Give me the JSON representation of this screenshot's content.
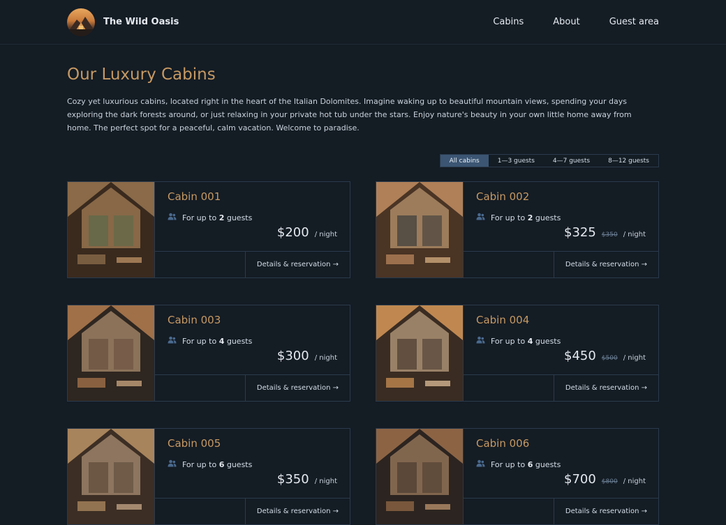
{
  "header": {
    "brand": "The Wild Oasis",
    "nav": [
      "Cabins",
      "About",
      "Guest area"
    ]
  },
  "page": {
    "title": "Our Luxury Cabins",
    "intro": "Cozy yet luxurious cabins, located right in the heart of the Italian Dolomites. Imagine waking up to beautiful mountain views, spending your days exploring the dark forests around, or just relaxing in your private hot tub under the stars. Enjoy nature's beauty in your own little home away from home. The perfect spot for a peaceful, calm vacation. Welcome to paradise."
  },
  "filter": {
    "options": [
      "All cabins",
      "1—3 guests",
      "4—7 guests",
      "8—12 guests"
    ],
    "active": "All cabins"
  },
  "cabin_ui": {
    "guests_prefix": "For up to",
    "guests_suffix": "guests",
    "per_night": "/ night",
    "details_label": "Details & reservation →"
  },
  "cabins": [
    {
      "name": "Cabin 001",
      "guests": "2",
      "price": "$200",
      "old_price": ""
    },
    {
      "name": "Cabin 002",
      "guests": "2",
      "price": "$325",
      "old_price": "$350"
    },
    {
      "name": "Cabin 003",
      "guests": "4",
      "price": "$300",
      "old_price": ""
    },
    {
      "name": "Cabin 004",
      "guests": "4",
      "price": "$450",
      "old_price": "$500"
    },
    {
      "name": "Cabin 005",
      "guests": "6",
      "price": "$350",
      "old_price": ""
    },
    {
      "name": "Cabin 006",
      "guests": "6",
      "price": "$700",
      "old_price": "$800"
    }
  ],
  "colors": {
    "background": "#141c24",
    "accent": "#c69963",
    "active_filter": "#3b5573",
    "border": "#2a3a4c"
  }
}
